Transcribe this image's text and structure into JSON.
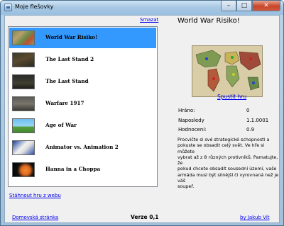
{
  "window": {
    "title": "Moje flešovky",
    "buttons": {
      "minimize": "–",
      "maximize": "□",
      "close": "✕"
    }
  },
  "list": {
    "delete_label": "Smazat",
    "download_label": "Stáhnout hru z webu",
    "selected_index": 0,
    "items": [
      {
        "label": "World War Risiko!",
        "thumb": "map-thumb"
      },
      {
        "label": "The Last Stand 2",
        "thumb": "dark-scene-thumb"
      },
      {
        "label": "The Last Stand",
        "thumb": "dark-scene-thumb"
      },
      {
        "label": "Warfare 1917",
        "thumb": "trench-thumb"
      },
      {
        "label": "Age of War",
        "thumb": "landscape-thumb"
      },
      {
        "label": "Animator vs. Animation 2",
        "thumb": "stickman-thumb"
      },
      {
        "label": "Hanna in a Choppa",
        "thumb": "helicopter-thumb"
      }
    ]
  },
  "detail": {
    "title": "World War Risiko!",
    "play_label": "Spustit hru",
    "stats": [
      {
        "label": "Hráno:",
        "value": "0"
      },
      {
        "label": "Naposledy",
        "value": "1.1.0001"
      },
      {
        "label": "Hodnocení:",
        "value": "0.9"
      }
    ],
    "description_lines": [
      "Procvičte si své strategické schopnosti a",
      "pokuste se obsadit celý svět. Ve hře si můžete",
      "vybrat až z 8 různých protivníků. Pamatujte, že",
      "pokud chcete obsadit sousední území, vaše",
      "armáda musí být silnější či vyrovnaná než je váš",
      "soupeř."
    ]
  },
  "footer": {
    "home_label": "Domovská stránka",
    "version_label": "Verze 0,1",
    "author_label": "by Jakub Vít"
  },
  "colors": {
    "selection": "#3399ff",
    "link": "#0000ee",
    "client_bg": "#f0f0f0",
    "titlebar": "#a8c8e4",
    "close_button": "#c8452a"
  }
}
